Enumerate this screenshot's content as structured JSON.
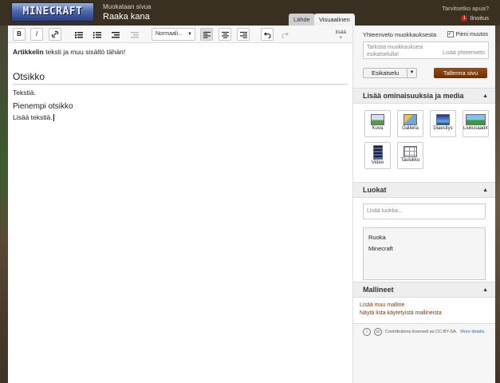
{
  "header": {
    "logo_text": "MINECRAFT",
    "editing_label": "Muokataan sivua",
    "page_title": "Raaka kana",
    "help_link": "Tarvitsetko apua?",
    "user_name": "Ilnoitus",
    "notification_count": "1",
    "tabs": [
      {
        "label": "Lähde",
        "active": false
      },
      {
        "label": "Visuaalinen",
        "active": true
      }
    ]
  },
  "toolbar": {
    "bold": "B",
    "italic": "I",
    "link": "🔗",
    "format_select": "Normaali...",
    "more_label": "lisää"
  },
  "content": {
    "intro_bold": "Artikkelin",
    "intro_rest": " teksti ja muu sisältö tähän!",
    "heading": "Otsikko",
    "paragraph1": "Tekstiä.",
    "subheading": "Pienempi otsikko",
    "paragraph2": "Lisää tekstiä."
  },
  "sidebar": {
    "summary_label": "Yhteenveto muokkauksesta",
    "minor_edit_label": "Pieni muutos",
    "minor_edit_checked": true,
    "summary_placeholder": "Tarkista muokkauksesi esikatselulla!",
    "summary_add": "Lisää yhteenveto",
    "preview_label": "Esikatselu",
    "save_label": "Tallenna sivu",
    "media_section": "Lisää ominaisuuksia ja media",
    "media_items": [
      {
        "label": "Kuva"
      },
      {
        "label": "Galleria"
      },
      {
        "label": "Diaesitys"
      },
      {
        "label": "Liukusäädin"
      },
      {
        "label": "Video"
      },
      {
        "label": "Taulukko"
      }
    ],
    "categories_section": "Luokat",
    "category_placeholder": "Lisää luokka...",
    "categories": [
      "Ruoka",
      "Minecraft"
    ],
    "templates_section": "Mallineet",
    "templates_links": [
      "Lisää muu malline",
      "Näytä lista käytetyistä mallineista"
    ],
    "license_text": "Contributions licensed as CC-BY-SA.",
    "license_more": "More details."
  }
}
